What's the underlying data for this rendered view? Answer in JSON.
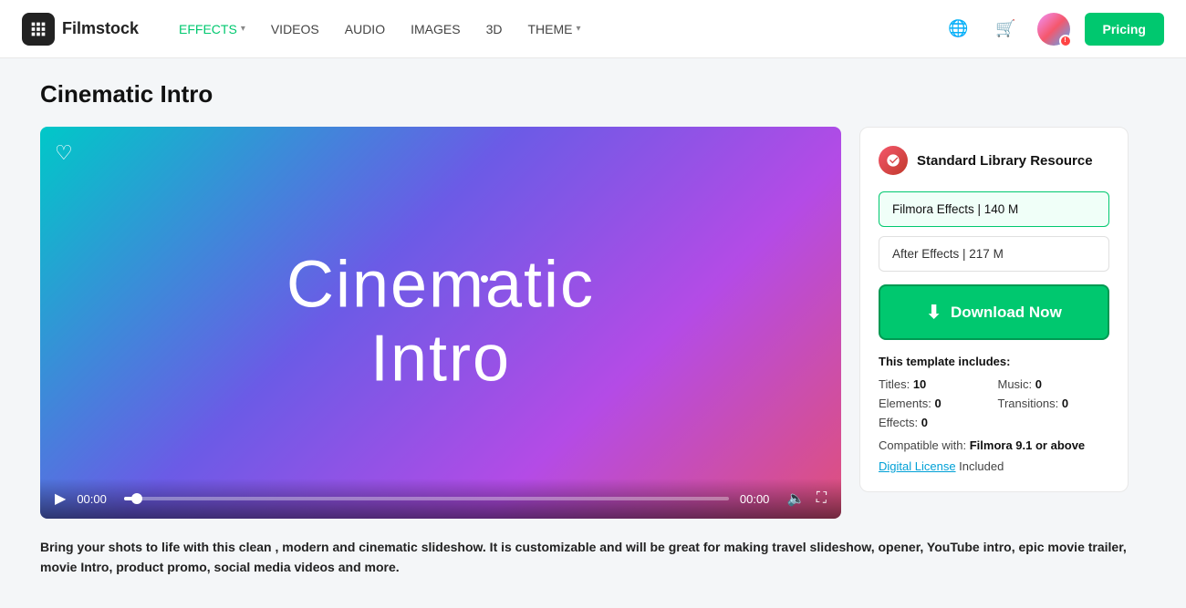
{
  "brand": {
    "name": "Filmstock"
  },
  "nav": {
    "links": [
      {
        "id": "effects",
        "label": "EFFECTS",
        "active": true,
        "hasDropdown": true
      },
      {
        "id": "videos",
        "label": "VIDEOS",
        "active": false,
        "hasDropdown": false
      },
      {
        "id": "audio",
        "label": "AUDIO",
        "active": false,
        "hasDropdown": false
      },
      {
        "id": "images",
        "label": "IMAGES",
        "active": false,
        "hasDropdown": false
      },
      {
        "id": "3d",
        "label": "3D",
        "active": false,
        "hasDropdown": false
      },
      {
        "id": "theme",
        "label": "THEME",
        "active": false,
        "hasDropdown": true
      }
    ],
    "pricing_label": "Pricing"
  },
  "page": {
    "title": "Cinematic Intro"
  },
  "video": {
    "title_line1": "Cinematic",
    "title_line2": "Intro",
    "time_current": "00:00",
    "time_total": "00:00",
    "heart_label": "♡"
  },
  "side_panel": {
    "resource_type": "Standard Library Resource",
    "formats": [
      {
        "id": "filmora",
        "label": "Filmora Effects | 140 M",
        "selected": true
      },
      {
        "id": "after_effects",
        "label": "After Effects | 217 M",
        "selected": false
      }
    ],
    "download_label": "Download Now",
    "template_includes_label": "This template includes:",
    "stats": [
      {
        "label": "Titles:",
        "value": "10"
      },
      {
        "label": "Music:",
        "value": "0"
      },
      {
        "label": "Elements:",
        "value": "0"
      },
      {
        "label": "Transitions:",
        "value": "0"
      },
      {
        "label": "Effects:",
        "value": "0"
      }
    ],
    "compatible_with": "Compatible with:",
    "compatible_version": "Filmora 9.1 or above",
    "digital_license": "Digital License",
    "included": "Included"
  },
  "description": "Bring your shots to life with this clean , modern and cinematic slideshow. It is customizable and will be great for making travel slideshow, opener, YouTube intro, epic movie trailer, movie Intro, product promo, social media videos and more."
}
